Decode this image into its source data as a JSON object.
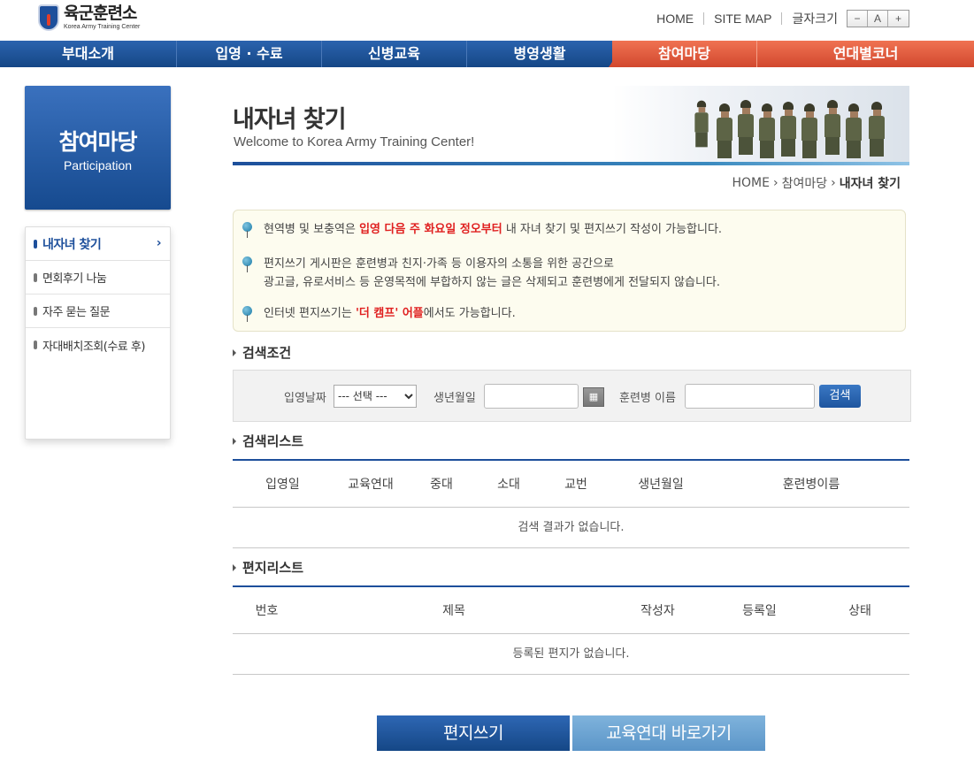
{
  "header": {
    "logo_ko": "육군훈련소",
    "logo_en": "Korea Army Training Center",
    "util": {
      "home": "HOME",
      "sitemap": "SITE MAP",
      "fontsize_label": "글자크기",
      "minus": "−",
      "a": "A",
      "plus": "+"
    }
  },
  "gnb": [
    "부대소개",
    "입영 · 수료",
    "신병교육",
    "병영생활",
    "참여마당",
    "연대별코너"
  ],
  "side": {
    "title_ko": "참여마당",
    "title_en": "Participation",
    "items": [
      "내자녀 찾기",
      "면회후기 나눔",
      "자주 묻는 질문",
      "자대배치조회(수료 후)"
    ],
    "arrow": "›"
  },
  "page": {
    "title": "내자녀 찾기",
    "subtitle": "Welcome to Korea Army Training Center!",
    "breadcrumb": [
      "HOME",
      "참여마당",
      "내자녀 찾기"
    ],
    "chev": "›"
  },
  "notice": {
    "l1_pre": "현역병 및 보충역은 ",
    "l1_red": "입영 다음 주 화요일 정오부터",
    "l1_post": " 내 자녀 찾기 및 편지쓰기 작성이 가능합니다.",
    "l2a": "편지쓰기 게시판은 훈련병과 친지·가족 등 이용자의 소통을 위한 공간으로",
    "l2b": "광고글, 유로서비스 등 운영목적에 부합하지 않는 글은 삭제되고 훈련병에게 전달되지 않습니다.",
    "l3_pre": "인터넷 편지쓰기는 ",
    "l3_red": "'더 캠프' 어플",
    "l3_post": "에서도 가능합니다."
  },
  "search": {
    "section": "검색조건",
    "date_label": "입영날짜",
    "date_selected": "--- 선택 ---",
    "birth_label": "생년월일",
    "name_label": "훈련병 이름",
    "button": "검색"
  },
  "result_list": {
    "section": "검색리스트",
    "columns": [
      "입영일",
      "교육연대",
      "중대",
      "소대",
      "교번",
      "생년월일",
      "훈련병이름"
    ],
    "empty": "검색 결과가 없습니다."
  },
  "letter_list": {
    "section": "편지리스트",
    "columns": [
      "번호",
      "제목",
      "작성자",
      "등록일",
      "상태"
    ],
    "empty": "등록된 편지가 없습니다."
  },
  "buttons": {
    "write": "편지쓰기",
    "goto": "교육연대 바로가기"
  },
  "colors": {
    "primary": "#1d4f9b",
    "accent": "#e0502f",
    "notice_bg": "#fdfcef",
    "red_text": "#e02020"
  }
}
